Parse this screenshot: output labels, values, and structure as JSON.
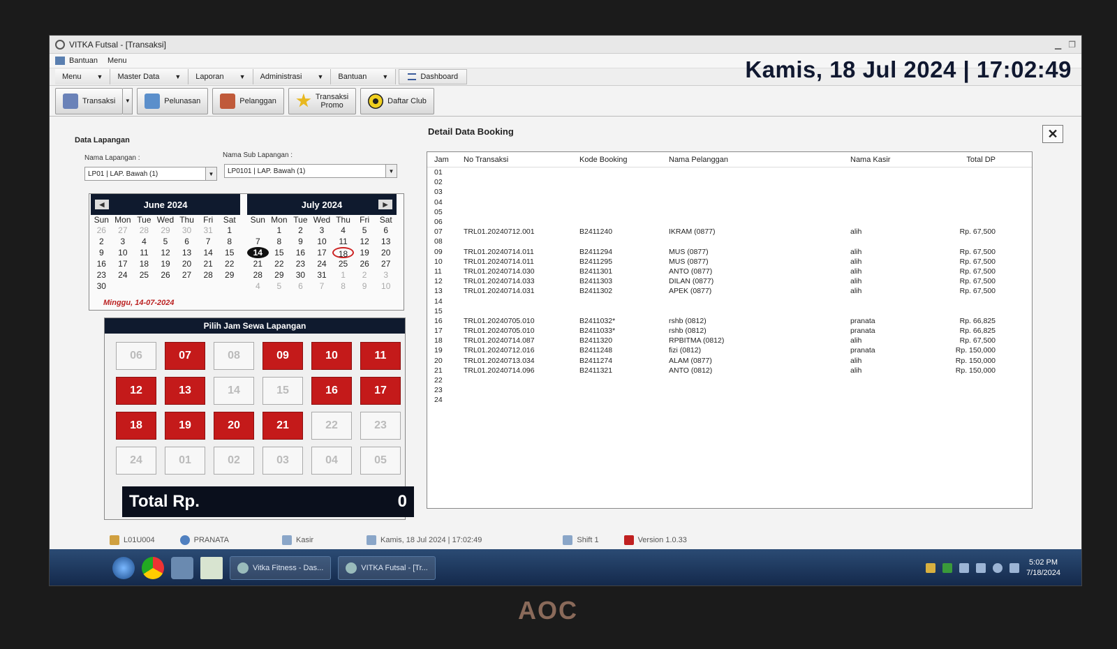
{
  "window": {
    "title": "VITKA Futsal - [Transaksi]"
  },
  "menubar": {
    "items": [
      "Bantuan",
      "Menu"
    ]
  },
  "navbar": {
    "items": [
      "Menu",
      "Master Data",
      "Laporan",
      "Administrasi",
      "Bantuan"
    ],
    "dashboard": "Dashboard"
  },
  "datetime": "Kamis, 18 Jul 2024 | 17:02:49",
  "toolbar": {
    "transaksi": "Transaksi",
    "pelunasan": "Pelunasan",
    "pelanggan": "Pelanggan",
    "promo_l1": "Transaksi",
    "promo_l2": "Promo",
    "daftar_club": "Daftar Club"
  },
  "data_lapangan": {
    "title": "Data Lapangan",
    "nama_lapangan_label": "Nama Lapangan  :",
    "nama_lapangan_value": "LP01 | LAP. Bawah (1)",
    "nama_sub_label": "Nama Sub Lapangan  :",
    "nama_sub_value": "LP0101 | LAP. Bawah (1)"
  },
  "calendar": {
    "months": [
      {
        "title": "June 2024",
        "days": [
          [
            "26",
            "27",
            "28",
            "29",
            "30",
            "31",
            "1"
          ],
          [
            "2",
            "3",
            "4",
            "5",
            "6",
            "7",
            "8"
          ],
          [
            "9",
            "10",
            "11",
            "12",
            "13",
            "14",
            "15"
          ],
          [
            "16",
            "17",
            "18",
            "19",
            "20",
            "21",
            "22"
          ],
          [
            "23",
            "24",
            "25",
            "26",
            "27",
            "28",
            "29"
          ],
          [
            "30",
            "",
            "",
            "",
            "",
            "",
            ""
          ]
        ]
      },
      {
        "title": "July 2024",
        "days": [
          [
            "",
            "1",
            "2",
            "3",
            "4",
            "5",
            "6"
          ],
          [
            "7",
            "8",
            "9",
            "10",
            "11",
            "12",
            "13"
          ],
          [
            "14",
            "15",
            "16",
            "17",
            "18",
            "19",
            "20"
          ],
          [
            "21",
            "22",
            "23",
            "24",
            "25",
            "26",
            "27"
          ],
          [
            "28",
            "29",
            "30",
            "31",
            "1",
            "2",
            "3"
          ],
          [
            "4",
            "5",
            "6",
            "7",
            "8",
            "9",
            "10"
          ]
        ]
      }
    ],
    "dow": [
      "Sun",
      "Mon",
      "Tue",
      "Wed",
      "Thu",
      "Fri",
      "Sat"
    ],
    "selected_label": "Minggu, 14-07-2024"
  },
  "jam": {
    "title": "Pilih Jam Sewa Lapangan",
    "slots": [
      {
        "label": "06",
        "booked": false
      },
      {
        "label": "07",
        "booked": true
      },
      {
        "label": "08",
        "booked": false
      },
      {
        "label": "09",
        "booked": true
      },
      {
        "label": "10",
        "booked": true
      },
      {
        "label": "11",
        "booked": true
      },
      {
        "label": "12",
        "booked": true
      },
      {
        "label": "13",
        "booked": true
      },
      {
        "label": "14",
        "booked": false
      },
      {
        "label": "15",
        "booked": false
      },
      {
        "label": "16",
        "booked": true
      },
      {
        "label": "17",
        "booked": true
      },
      {
        "label": "18",
        "booked": true
      },
      {
        "label": "19",
        "booked": true
      },
      {
        "label": "20",
        "booked": true
      },
      {
        "label": "21",
        "booked": true
      },
      {
        "label": "22",
        "booked": false
      },
      {
        "label": "23",
        "booked": false
      },
      {
        "label": "24",
        "booked": false
      },
      {
        "label": "01",
        "booked": false
      },
      {
        "label": "02",
        "booked": false
      },
      {
        "label": "03",
        "booked": false
      },
      {
        "label": "04",
        "booked": false
      },
      {
        "label": "05",
        "booked": false
      }
    ]
  },
  "total": {
    "label": "Total  Rp.",
    "value": "0"
  },
  "detail": {
    "title": "Detail Data Booking",
    "headers": [
      "Jam",
      "No Transaksi",
      "Kode Booking",
      "Nama Pelanggan",
      "Nama Kasir",
      "Total DP"
    ],
    "rows": [
      [
        "01",
        "",
        "",
        "",
        "",
        ""
      ],
      [
        "02",
        "",
        "",
        "",
        "",
        ""
      ],
      [
        "03",
        "",
        "",
        "",
        "",
        ""
      ],
      [
        "04",
        "",
        "",
        "",
        "",
        ""
      ],
      [
        "05",
        "",
        "",
        "",
        "",
        ""
      ],
      [
        "06",
        "",
        "",
        "",
        "",
        ""
      ],
      [
        "07",
        "TRL01.20240712.001",
        "B2411240",
        "IKRAM (0877)",
        "alih",
        "Rp.  67,500"
      ],
      [
        "08",
        "",
        "",
        "",
        "",
        ""
      ],
      [
        "09",
        "TRL01.20240714.011",
        "B2411294",
        "MUS (0877)",
        "alih",
        "Rp.  67,500"
      ],
      [
        "10",
        "TRL01.20240714.011",
        "B2411295",
        "MUS (0877)",
        "alih",
        "Rp.  67,500"
      ],
      [
        "11",
        "TRL01.20240714.030",
        "B2411301",
        "ANTO (0877)",
        "alih",
        "Rp.  67,500"
      ],
      [
        "12",
        "TRL01.20240714.033",
        "B2411303",
        "DILAN (0877)",
        "alih",
        "Rp.  67,500"
      ],
      [
        "13",
        "TRL01.20240714.031",
        "B2411302",
        "APEK (0877)",
        "alih",
        "Rp.  67,500"
      ],
      [
        "14",
        "",
        "",
        "",
        "",
        ""
      ],
      [
        "15",
        "",
        "",
        "",
        "",
        ""
      ],
      [
        "16",
        "TRL01.20240705.010",
        "B2411032*",
        "rshb (0812)",
        "pranata",
        "Rp.  66,825"
      ],
      [
        "17",
        "TRL01.20240705.010",
        "B2411033*",
        "rshb (0812)",
        "pranata",
        "Rp.  66,825"
      ],
      [
        "18",
        "TRL01.20240714.087",
        "B2411320",
        "RPBITMA (0812)",
        "alih",
        "Rp.  67,500"
      ],
      [
        "19",
        "TRL01.20240712.016",
        "B2411248",
        "fizi (0812)",
        "pranata",
        "Rp.  150,000"
      ],
      [
        "20",
        "TRL01.20240713.034",
        "B2411274",
        "ALAM (0877)",
        "alih",
        "Rp.  150,000"
      ],
      [
        "21",
        "TRL01.20240714.096",
        "B2411321",
        "ANTO (0812)",
        "alih",
        "Rp.  150,000"
      ],
      [
        "22",
        "",
        "",
        "",
        "",
        ""
      ],
      [
        "23",
        "",
        "",
        "",
        "",
        ""
      ],
      [
        "24",
        "",
        "",
        "",
        "",
        ""
      ]
    ]
  },
  "status": {
    "user_id": "L01U004",
    "user_name": "PRANATA",
    "role": "Kasir",
    "datetime": "Kamis, 18 Jul 2024 | 17:02:49",
    "shift": "Shift 1",
    "version": "Version 1.0.33"
  },
  "taskbar": {
    "task1": "Vitka Fitness - Das...",
    "task2": "VITKA Futsal - [Tr...",
    "time": "5:02 PM",
    "date": "7/18/2024"
  },
  "monitor_brand": "AOC",
  "colors": {
    "booked": "#c41a1a",
    "header_dark": "#0f1a2e"
  }
}
